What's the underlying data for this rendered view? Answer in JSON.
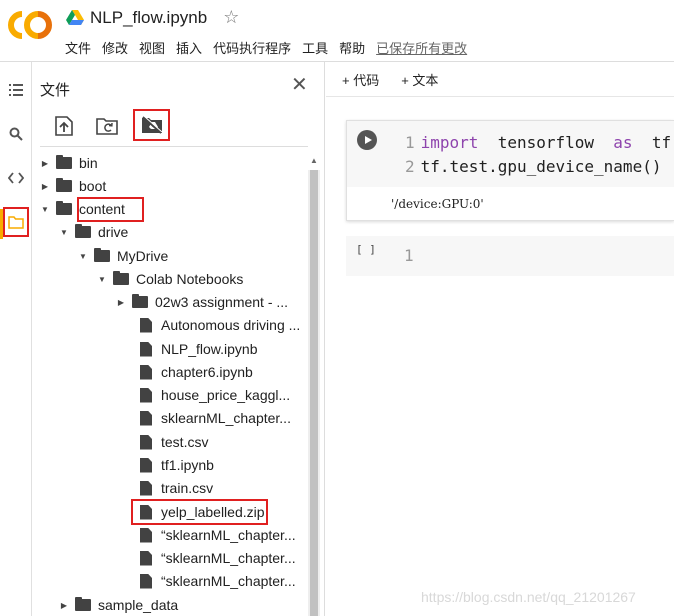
{
  "header": {
    "logo": "CO",
    "notebook_title": "NLP_flow.ipynb",
    "menu": [
      "文件",
      "修改",
      "视图",
      "插入",
      "代码执行程序",
      "工具",
      "帮助"
    ],
    "saved_status": "已保存所有更改"
  },
  "rail": {
    "icons": [
      "list-icon",
      "search-icon",
      "code-icon",
      "folder-icon"
    ]
  },
  "sidebar": {
    "title": "文件",
    "toolbar": [
      "upload-icon",
      "refresh-folder-icon",
      "mount-drive-icon"
    ],
    "tree": [
      {
        "label": "bin",
        "type": "folder"
      },
      {
        "label": "boot",
        "type": "folder"
      },
      {
        "label": "content",
        "type": "folder"
      },
      {
        "label": "drive",
        "type": "folder"
      },
      {
        "label": "MyDrive",
        "type": "folder"
      },
      {
        "label": "Colab Notebooks",
        "type": "folder"
      },
      {
        "label": "02w3 assignment - ...",
        "type": "folder"
      },
      {
        "label": "Autonomous driving ...",
        "type": "file"
      },
      {
        "label": "NLP_flow.ipynb",
        "type": "file"
      },
      {
        "label": "chapter6.ipynb",
        "type": "file"
      },
      {
        "label": "house_price_kaggl...",
        "type": "file"
      },
      {
        "label": "sklearnML_chapter...",
        "type": "file"
      },
      {
        "label": "test.csv",
        "type": "file"
      },
      {
        "label": "tf1.ipynb",
        "type": "file"
      },
      {
        "label": "train.csv",
        "type": "file"
      },
      {
        "label": "yelp_labelled.zip",
        "type": "file"
      },
      {
        "label": "“sklearnML_chapter...",
        "type": "file"
      },
      {
        "label": "“sklearnML_chapter...",
        "type": "file"
      },
      {
        "label": "“sklearnML_chapter...",
        "type": "file"
      },
      {
        "label": "sample_data",
        "type": "folder"
      }
    ]
  },
  "notebook": {
    "add_code": "+ 代码",
    "add_text": "+ 文本",
    "cell1": {
      "line1_no": "1",
      "line1_kw1": "import",
      "line1_mod": "tensorflow",
      "line1_kw2": "as",
      "line1_alias": "tf",
      "line2_no": "2",
      "line2_code": "tf.test.gpu_device_name()",
      "output": "'/device:GPU:0'"
    },
    "cell2": {
      "exec_marker": "[ ]",
      "line_no": "1"
    }
  },
  "watermark": "https://blog.csdn.net/qq_21201267"
}
